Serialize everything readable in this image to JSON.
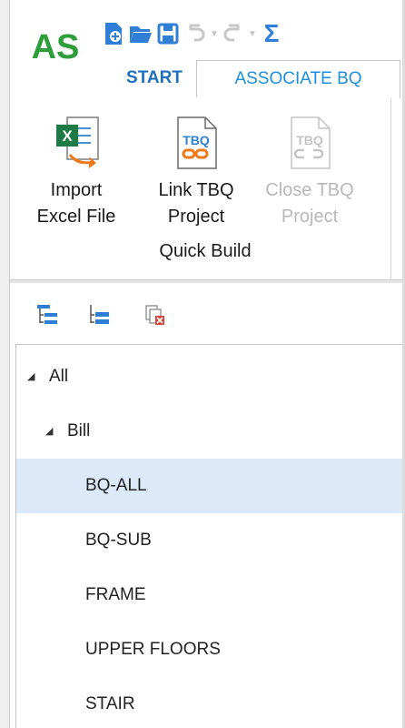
{
  "app": {
    "logo_text": "AS",
    "brand_color": "#2e9e3a",
    "accent_color": "#1e8fe0"
  },
  "quick_access": {
    "new_icon": "new-file-icon",
    "open_icon": "folder-open-icon",
    "save_icon": "save-icon",
    "undo_icon": "undo-icon",
    "redo_icon": "redo-icon",
    "sum_label": "Σ"
  },
  "tabs": [
    {
      "label": "START"
    },
    {
      "label": "ASSOCIATE BQ",
      "active": true
    }
  ],
  "ribbon": {
    "import_line1": "Import",
    "import_line2": "Excel File",
    "link_line1": "Link TBQ",
    "link_line2": "Project",
    "close_line1": "Close TBQ",
    "close_line2": "Project",
    "close_disabled": true,
    "group_label": "Quick Build",
    "tbq_icon_text": "TBQ"
  },
  "tree_toolbar": {
    "expand_icon": "expand-all-icon",
    "collapse_icon": "collapse-all-icon",
    "clear_icon": "delete-icon"
  },
  "tree": {
    "root": "All",
    "bill": "Bill",
    "items": [
      "BQ-ALL",
      "BQ-SUB",
      "FRAME",
      "UPPER FLOORS",
      "STAIR"
    ],
    "selected": "BQ-ALL",
    "expanded_glyph": "◢"
  }
}
